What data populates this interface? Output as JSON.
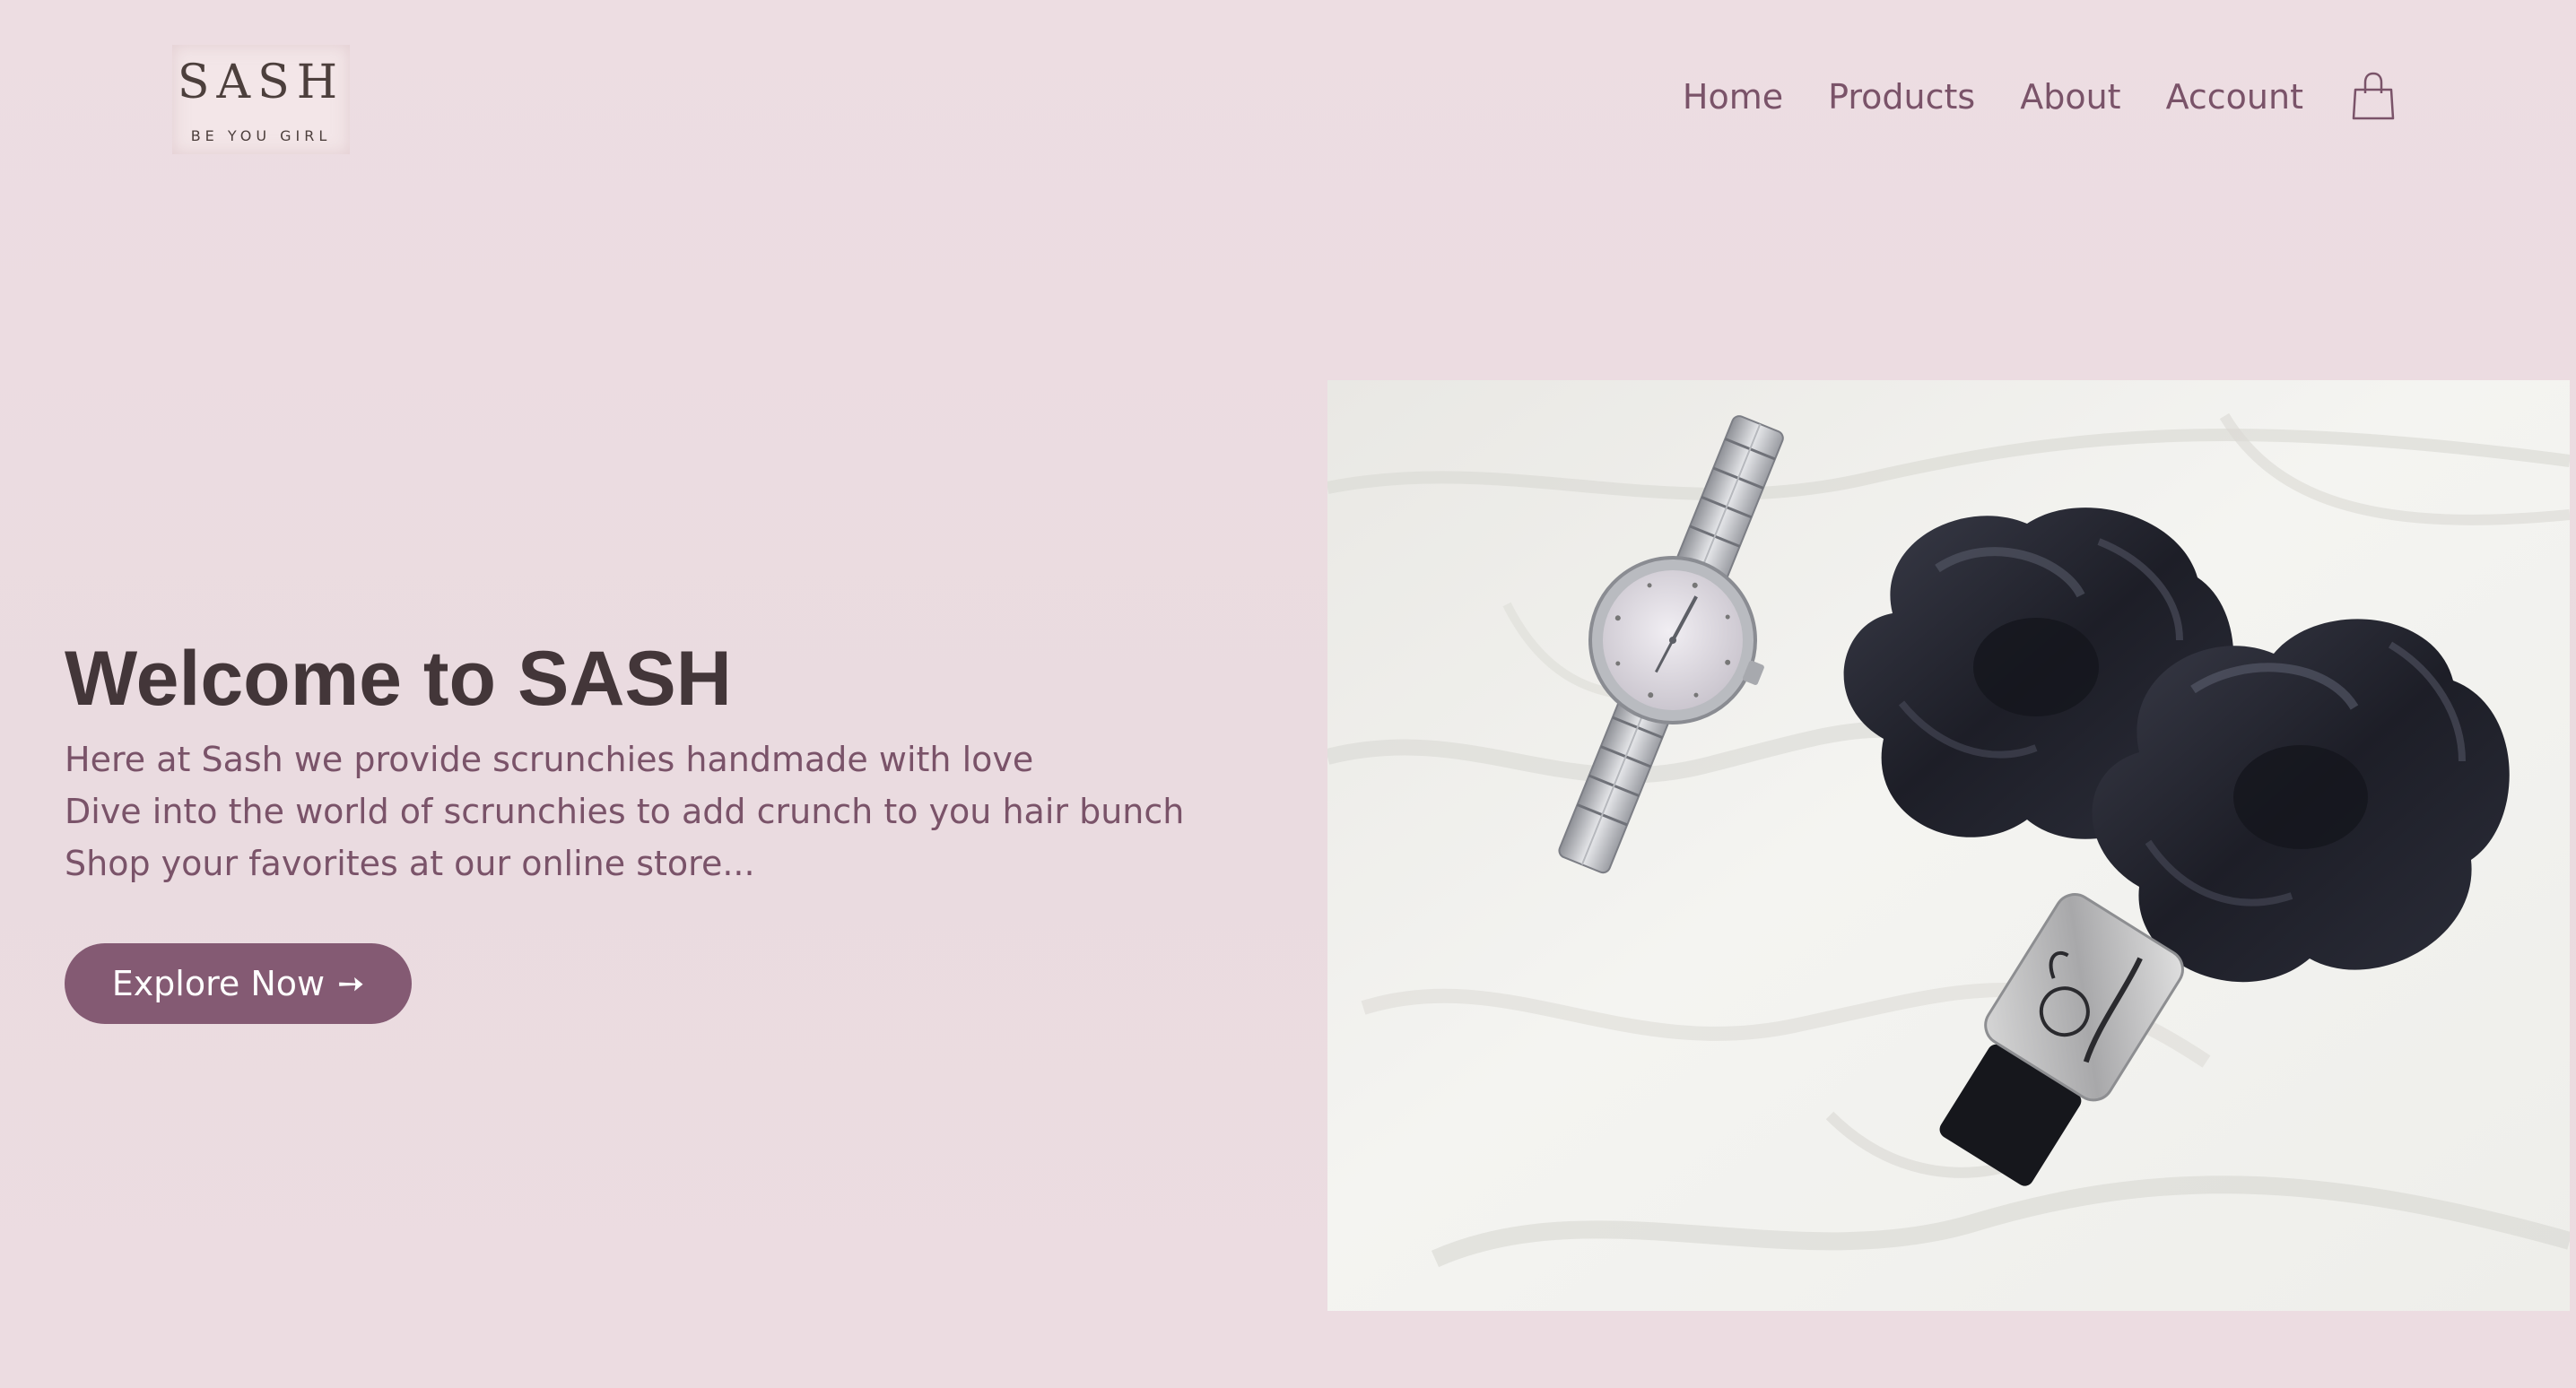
{
  "logo": {
    "wordmark": "SASH",
    "tagline": "BE YOU GIRL"
  },
  "nav": {
    "items": [
      {
        "label": "Home"
      },
      {
        "label": "Products"
      },
      {
        "label": "About"
      },
      {
        "label": "Account"
      }
    ],
    "cart_icon": "shopping-bag-icon"
  },
  "hero": {
    "title": "Welcome to SASH",
    "lines": [
      "Here at Sash we provide scrunchies handmade with love",
      "Dive into the world of scrunchies to add crunch to you hair bunch",
      "Shop your favorites at our online store..."
    ],
    "cta_label": "Explore Now",
    "cta_icon": "arrow-right-icon"
  },
  "colors": {
    "background": "#ecdbe0",
    "accent": "#845a73",
    "nav_text": "#7a5369",
    "heading": "#433639"
  }
}
